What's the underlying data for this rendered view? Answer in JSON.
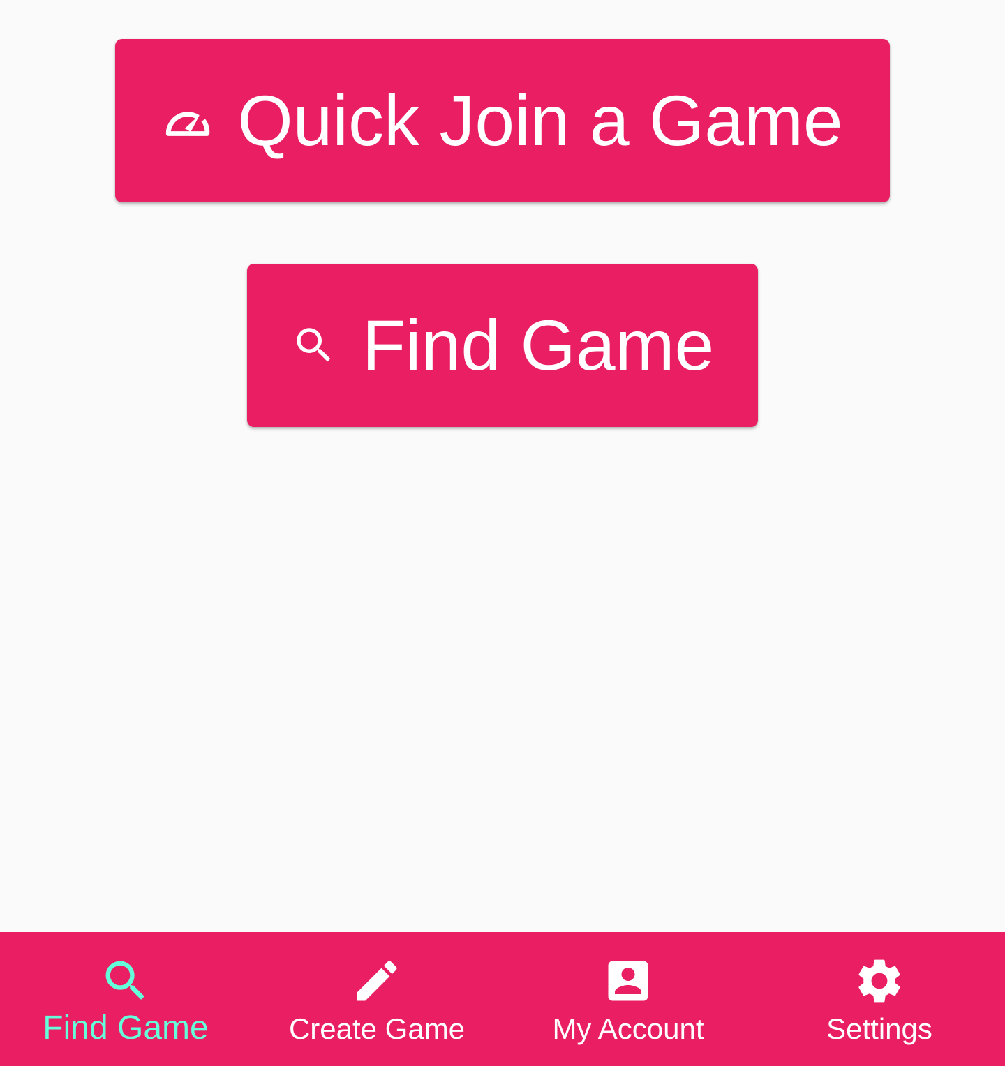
{
  "colors": {
    "primary": "#e91e63",
    "accent": "#64ffda",
    "background": "#fafafa",
    "on_primary": "#ffffff"
  },
  "main": {
    "quick_join": {
      "icon": "speedometer-icon",
      "label": "Quick Join a Game"
    },
    "find_game": {
      "icon": "search-icon",
      "label": "Find Game"
    }
  },
  "bottom_nav": {
    "active_index": 0,
    "items": [
      {
        "icon": "search-icon",
        "label": "Find Game"
      },
      {
        "icon": "pencil-icon",
        "label": "Create Game"
      },
      {
        "icon": "account-box-icon",
        "label": "My Account"
      },
      {
        "icon": "gear-icon",
        "label": "Settings"
      }
    ]
  }
}
